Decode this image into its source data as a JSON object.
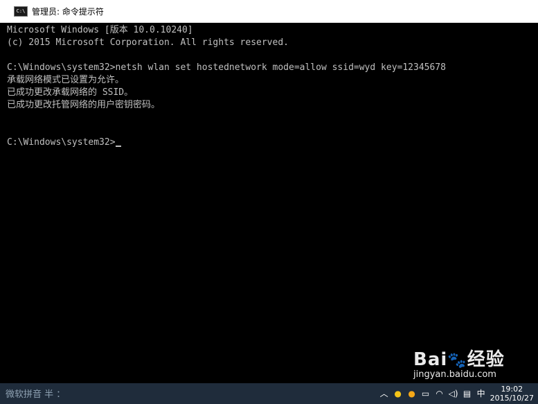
{
  "window": {
    "title": "管理员: 命令提示符",
    "icon": "cmd-icon"
  },
  "console": {
    "lines": [
      "Microsoft Windows [版本 10.0.10240]",
      "(c) 2015 Microsoft Corporation. All rights reserved.",
      "",
      "C:\\Windows\\system32>netsh wlan set hostednetwork mode=allow ssid=wyd key=12345678",
      "承载网络模式已设置为允许。",
      "已成功更改承载网络的 SSID。",
      "已成功更改托管网络的用户密钥密码。",
      "",
      "",
      "C:\\Windows\\system32>"
    ]
  },
  "taskbar": {
    "ime_text": "微软拼音 半 ：",
    "tray_icons": [
      "chevron-up-icon",
      "qq-icon",
      "qq-icon",
      "network-icon",
      "wifi-icon",
      "volume-icon",
      "keyboard-icon",
      "ime-icon"
    ],
    "ime_label": "中",
    "time": "19:02",
    "date": "2015/10/27"
  },
  "watermark": {
    "brand": "Bai",
    "brand_suffix": "经验",
    "site": "jingyan.baidu.com"
  }
}
